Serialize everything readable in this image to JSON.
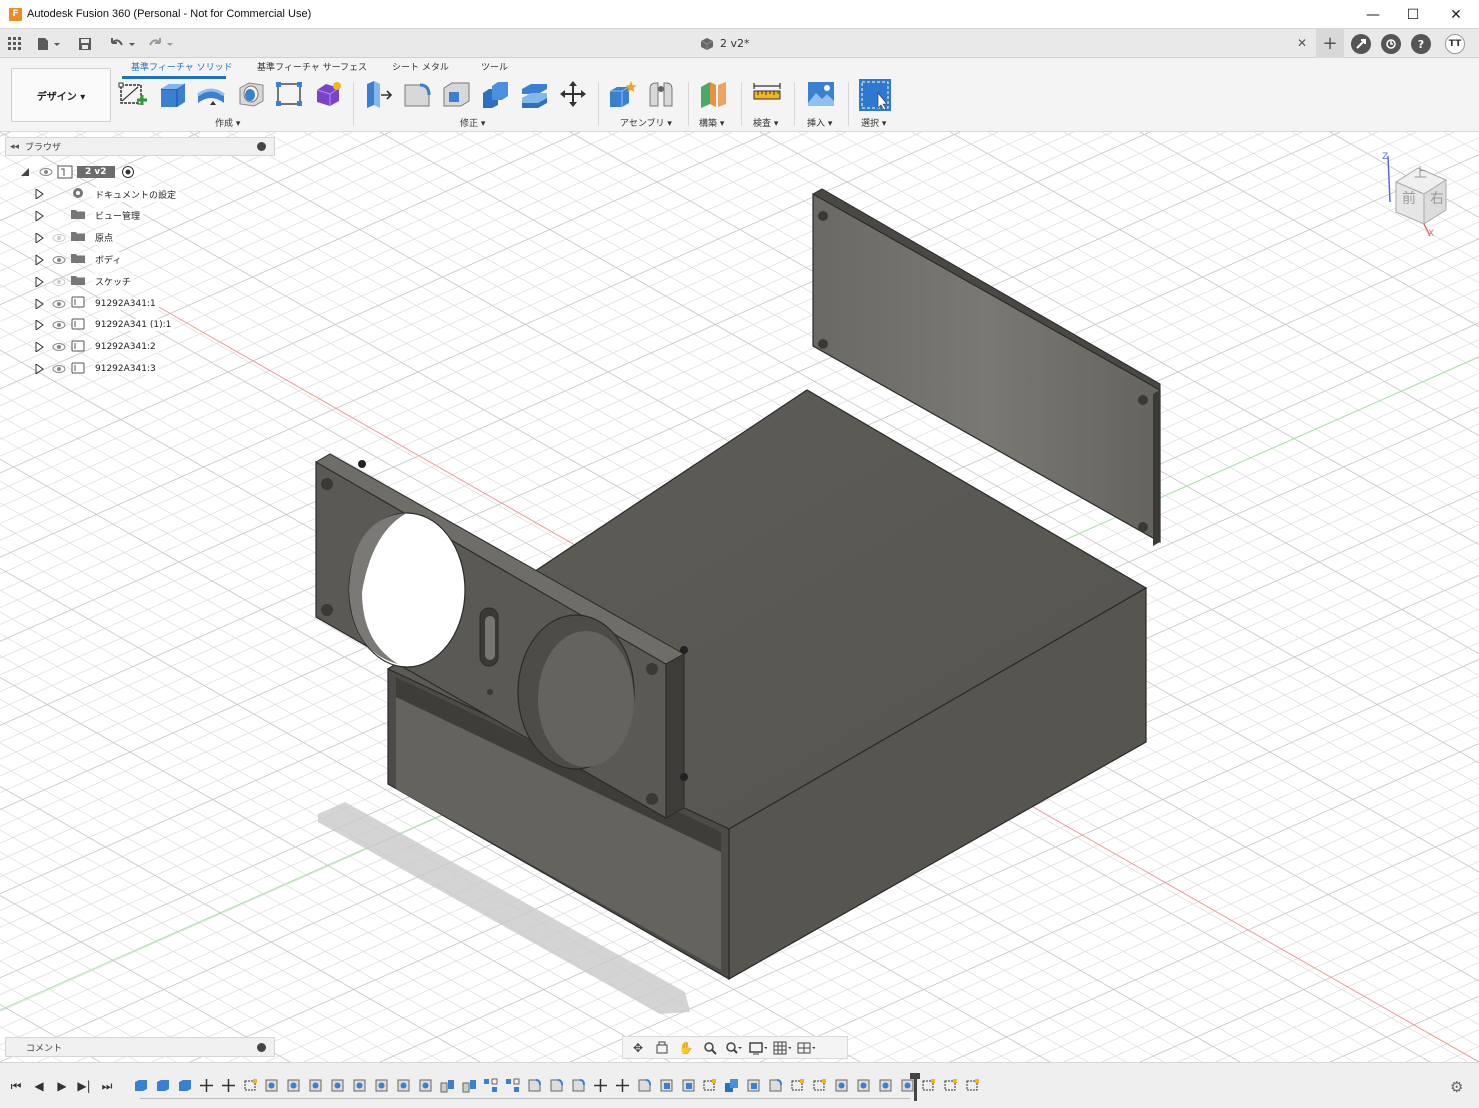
{
  "window": {
    "app_logo_letter": "F",
    "title": "Autodesk Fusion 360 (Personal - Not for Commercial Use)",
    "minimize_glyph": "—",
    "maximize_glyph": "☐",
    "close_glyph": "✕"
  },
  "tabbar": {
    "document_tab": "2 v2*",
    "close_tab_glyph": "✕",
    "new_tab_glyph": "+",
    "user_initials": "TT",
    "help_glyph": "?"
  },
  "toolbar": {
    "workspace": "デザイン ▾",
    "tabs": [
      "基準フィーチャ ソリッド",
      "基準フィーチャ サーフェス",
      "シート メタル",
      "ツール"
    ],
    "groups": {
      "create": "作成 ▾",
      "modify": "修正 ▾",
      "assemble": "アセンブリ ▾",
      "construct": "構築 ▾",
      "inspect": "検査 ▾",
      "insert": "挿入 ▾",
      "select": "選択 ▾"
    }
  },
  "browser": {
    "title": "ブラウザ",
    "root": "2 v2",
    "items": [
      {
        "label": "ドキュメントの設定",
        "icon": "gear-icon"
      },
      {
        "label": "ビュー管理",
        "icon": "folder-icon"
      },
      {
        "label": "原点",
        "icon": "folder-icon"
      },
      {
        "label": "ボディ",
        "icon": "folder-icon"
      },
      {
        "label": "スケッチ",
        "icon": "folder-icon"
      },
      {
        "label": "91292A341:1",
        "icon": "component-icon"
      },
      {
        "label": "91292A341 (1):1",
        "icon": "component-icon"
      },
      {
        "label": "91292A341:2",
        "icon": "component-icon"
      },
      {
        "label": "91292A341:3",
        "icon": "component-icon"
      }
    ]
  },
  "viewcube": {
    "top": "上",
    "front": "前",
    "right": "右",
    "axis_z": "Z",
    "axis_x": "X"
  },
  "comments": {
    "label": "コメント"
  },
  "colors": {
    "accent": "#1a73c9",
    "body": "#5e5c57",
    "body_dark": "#45433f",
    "panel": "#f4f4f4"
  }
}
